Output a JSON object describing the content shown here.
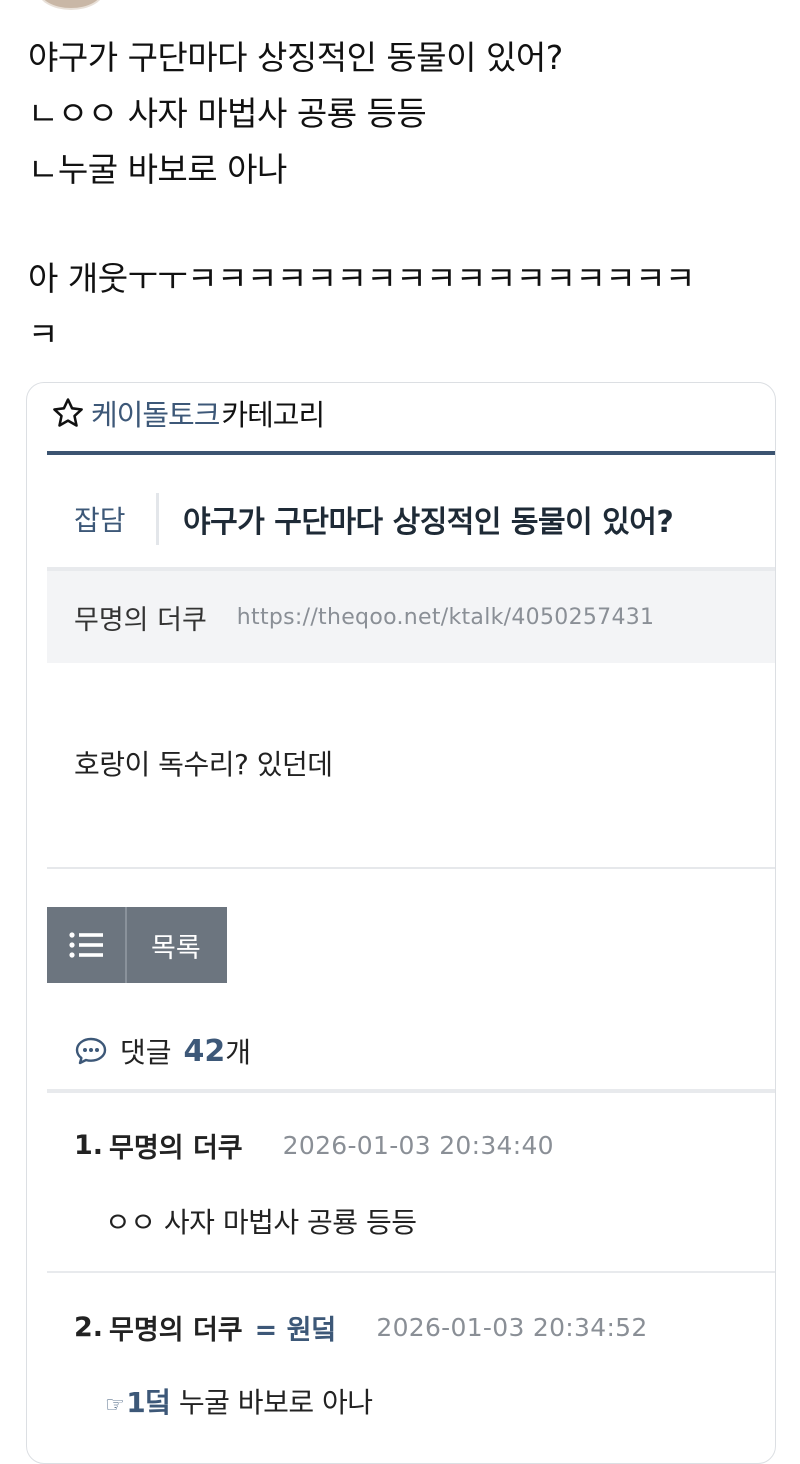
{
  "tweet": {
    "lines": [
      "야구가 구단마다 상징적인 동물이 있어?",
      "ㄴㅇㅇ 사자 마법사 공룡 등등",
      "ㄴ누굴 바보로 아나",
      "",
      "아 개웃ㅜㅜㅋㅋㅋㅋㅋㅋㅋㅋㅋㅋㅋㅋㅋㅋㅋㅋㅋ",
      "ㅋ"
    ]
  },
  "card": {
    "category_header": {
      "icon": "star-outline-icon",
      "name": "케이돌토크",
      "suffix": "카테고리"
    },
    "post": {
      "category": "잡담",
      "title": "야구가 구단마다 상징적인 동물이 있어?",
      "author": "무명의 더쿠",
      "url": "https://theqoo.net/ktalk/4050257431",
      "body": "호랑이 독수리? 있던데"
    },
    "list_button": {
      "icon": "list-icon",
      "label": "목록"
    },
    "comments_header": {
      "icon": "speech-bubble-icon",
      "label": "댓글",
      "count": "42",
      "unit": "개"
    },
    "comments": [
      {
        "number": "1.",
        "author": "무명의 더쿠",
        "op_tag": "",
        "date": "2026-01-03 20:34:40",
        "reply_ref": "",
        "text": "ㅇㅇ 사자 마법사 공룡 등등"
      },
      {
        "number": "2.",
        "author": "무명의 더쿠",
        "op_tag": "= 원덬",
        "date": "2026-01-03 20:34:52",
        "reply_ref": "1덬",
        "text": "누굴 바보로 아나"
      }
    ],
    "colors": {
      "accent": "#3d5878",
      "header_rule": "#3c5471",
      "button_bg": "#6c757f",
      "meta_bg": "#f3f4f6"
    }
  }
}
